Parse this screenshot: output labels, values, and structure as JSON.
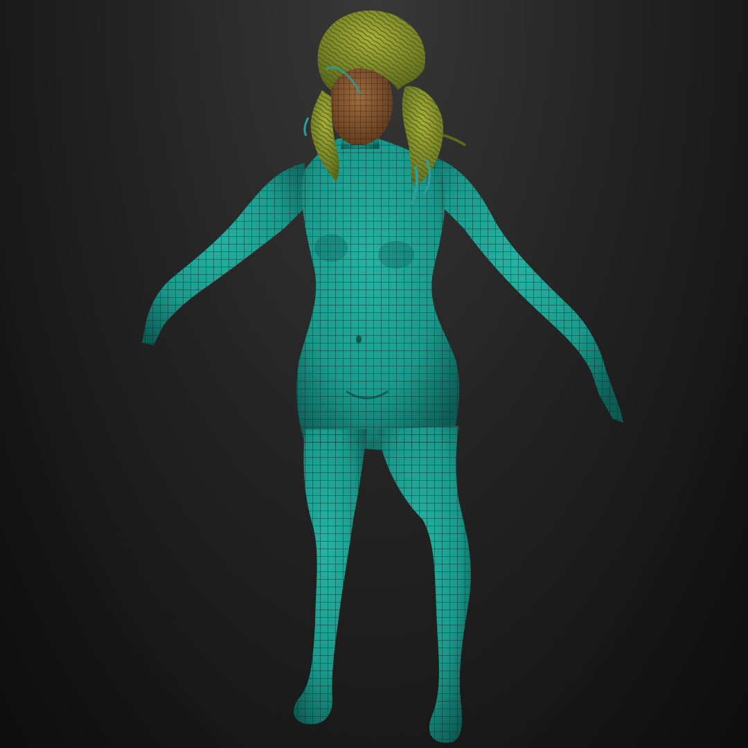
{
  "scene": {
    "subject": "3d-mannequin-model",
    "colors": {
      "background_top": "#383838",
      "background_bottom": "#0d0d0d",
      "mesh_body": "#1fa596",
      "mesh_body_shadow": "#0d5c55",
      "mesh_skin_head": "#8a5a32",
      "hair": "#8f9a2c",
      "hair_dark": "#4e5a18",
      "hair_accent": "#2aa0a0",
      "wireframe": "#0a2e2a"
    }
  }
}
